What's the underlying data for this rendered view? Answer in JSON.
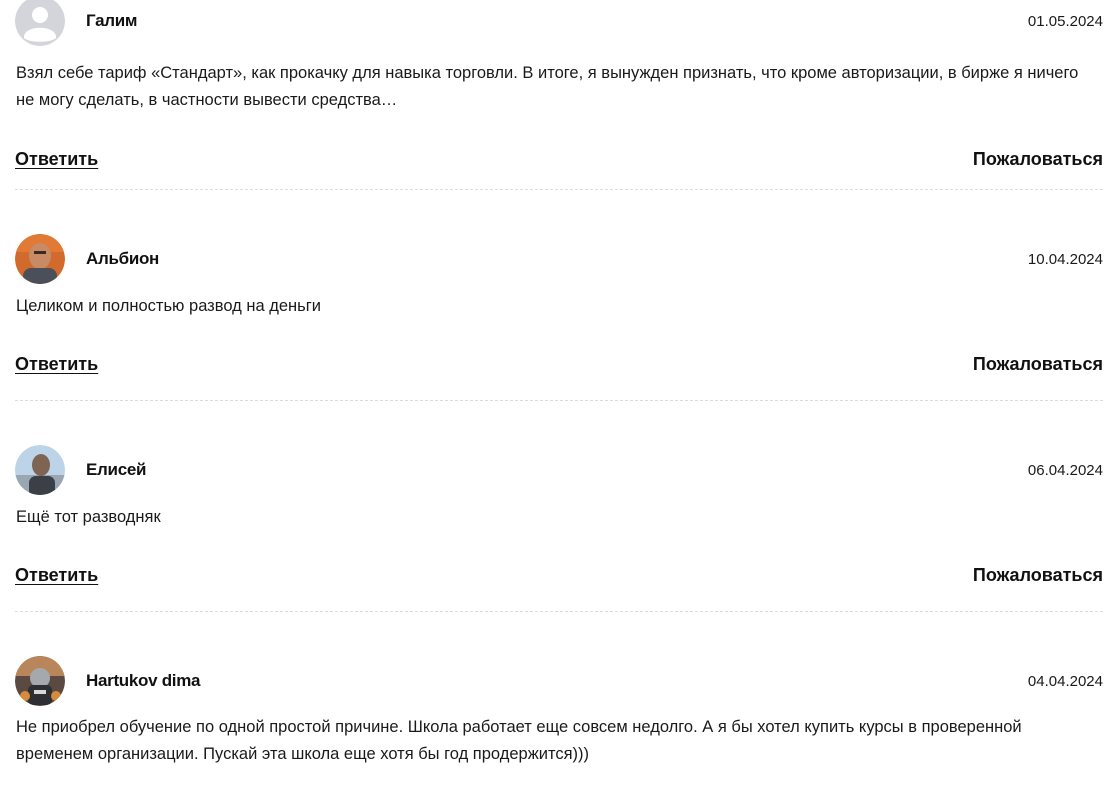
{
  "comments": [
    {
      "author": "Галим",
      "date": "01.05.2024",
      "text": "Взял себе тариф «Стандарт», как прокачку для навыка торговли. В итоге, я вынужден признать, что кроме авторизации, в бирже я ничего не могу сделать, в частности вывести средства…",
      "reply_label": "Ответить",
      "complain_label": "Пожаловаться",
      "avatar_icon": "default-user-avatar-icon"
    },
    {
      "author": "Альбион",
      "date": "10.04.2024",
      "text": "Целиком и полностью развод на деньги",
      "reply_label": "Ответить",
      "complain_label": "Пожаловаться",
      "avatar_icon": "user-photo-avatar"
    },
    {
      "author": "Елисей",
      "date": "06.04.2024",
      "text": "Ещё тот разводняк",
      "reply_label": "Ответить",
      "complain_label": "Пожаловаться",
      "avatar_icon": "user-photo-avatar"
    },
    {
      "author": "Hartukov dima",
      "date": "04.04.2024",
      "text": "Не приобрел обучение по одной простой причине. Школа работает еще совсем недолго. А я бы хотел купить курсы в проверенной временем организации. Пускай эта школа еще хотя бы год продержится)))",
      "reply_label": "Ответить",
      "complain_label": "Пожаловаться",
      "avatar_icon": "user-photo-avatar"
    }
  ]
}
